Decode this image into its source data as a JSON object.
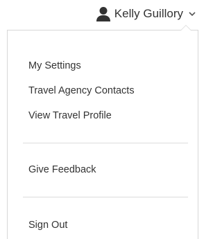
{
  "user": {
    "name": "Kelly Guillory",
    "icon": "person-icon",
    "dropdown_icon": "chevron-down-icon"
  },
  "menu": {
    "group_1": [
      {
        "label": "My Settings"
      },
      {
        "label": "Travel Agency Contacts"
      },
      {
        "label": "View Travel Profile"
      }
    ],
    "group_2": [
      {
        "label": "Give Feedback"
      }
    ],
    "group_3": [
      {
        "label": "Sign Out"
      }
    ]
  },
  "colors": {
    "text": "#333333",
    "border": "#d7d7d7",
    "divider": "#dcdcdc",
    "background": "#ffffff"
  }
}
